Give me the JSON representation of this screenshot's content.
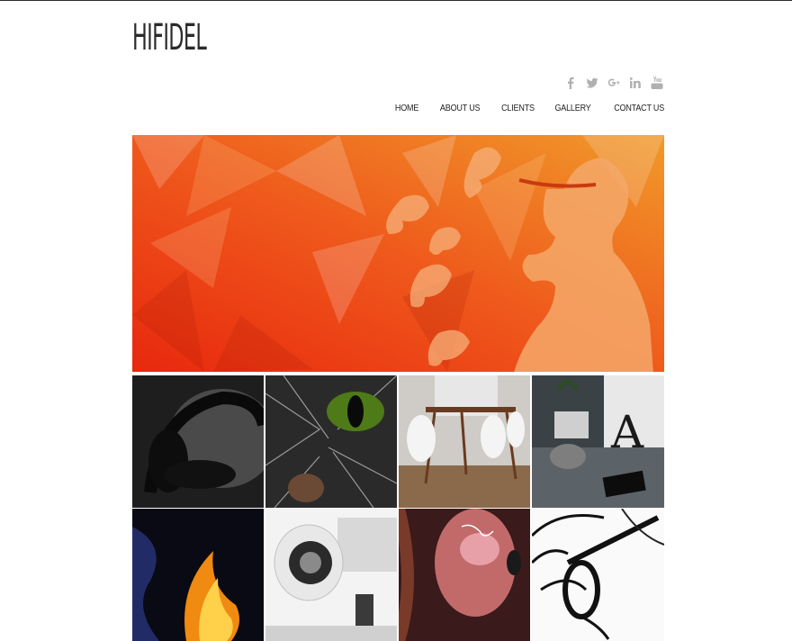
{
  "site": {
    "logo": "HIFIDEL"
  },
  "social": [
    {
      "icon": "facebook-icon"
    },
    {
      "icon": "twitter-icon"
    },
    {
      "icon": "google-plus-icon"
    },
    {
      "icon": "linkedin-icon"
    },
    {
      "icon": "youtube-icon"
    }
  ],
  "nav": {
    "items": [
      {
        "label": "HOME"
      },
      {
        "label": "ABOUT US"
      },
      {
        "label": "CLIENTS"
      },
      {
        "label": "GALLERY"
      },
      {
        "label": "CONTACT US"
      }
    ]
  },
  "hero": {
    "image": "orange-polygon-woman-butterflies"
  },
  "gallery": {
    "tiles": [
      {
        "image": "headphones"
      },
      {
        "image": "cat-eye"
      },
      {
        "image": "dining-room"
      },
      {
        "image": "letter-a-decor"
      },
      {
        "image": "flame"
      },
      {
        "image": "speaker"
      },
      {
        "image": "face-art"
      },
      {
        "image": "sketch-glasses"
      }
    ]
  },
  "colors": {
    "accent": "#e8501c",
    "text": "#222222",
    "icon": "#b0b0b0"
  }
}
